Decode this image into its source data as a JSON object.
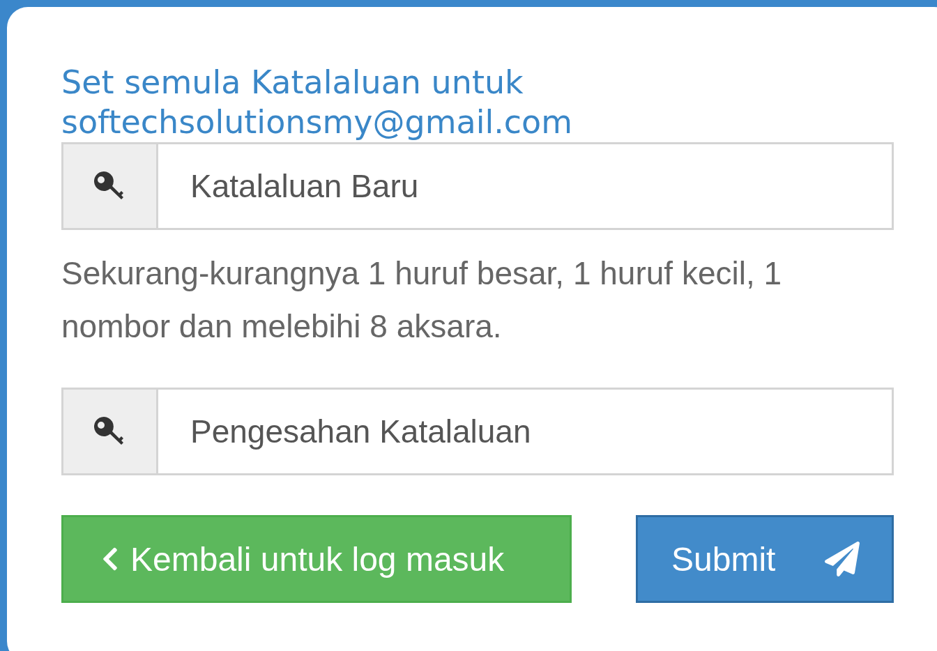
{
  "title": "Set semula Katalaluan untuk softechsolutionsmy@gmail.com",
  "fields": [
    {
      "placeholder": "Katalaluan Baru",
      "help": "Sekurang-kurangnya 1 huruf besar, 1 huruf kecil, 1 nombor dan melebihi 8 aksara."
    },
    {
      "placeholder": "Pengesahan Katalaluan"
    }
  ],
  "buttons": [
    {
      "kind": "back",
      "label": "Kembali untuk log masuk"
    },
    {
      "kind": "submit",
      "label": "Submit"
    }
  ]
}
